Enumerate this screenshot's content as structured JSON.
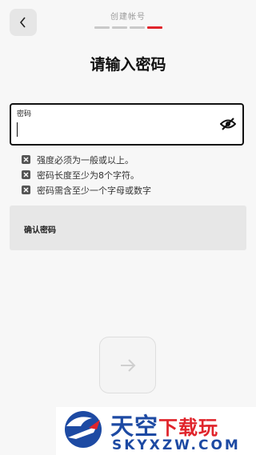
{
  "header": {
    "step_title": "创建帐号",
    "progress_total": 4,
    "progress_current": 4
  },
  "page_title": "请输入密码",
  "password": {
    "label": "密码",
    "value": "",
    "icon": "eye-off-icon"
  },
  "rules": [
    {
      "text": "强度必须为一般或以上。",
      "icon": "x-box-icon"
    },
    {
      "text": "密码长度至少为8个字符。",
      "icon": "x-box-icon"
    },
    {
      "text": "密码需含至少一个字母或数字",
      "icon": "x-box-icon"
    }
  ],
  "confirm": {
    "label": "确认密码"
  },
  "next_button": {
    "icon": "arrow-right-icon"
  },
  "watermark": {
    "name_blue": "天空",
    "name_red": "下载玩",
    "url": "SKYXZW.COM"
  },
  "colors": {
    "accent": "#e0242b",
    "background": "#f7f7f7",
    "brand_blue": "#1d4aa3"
  }
}
